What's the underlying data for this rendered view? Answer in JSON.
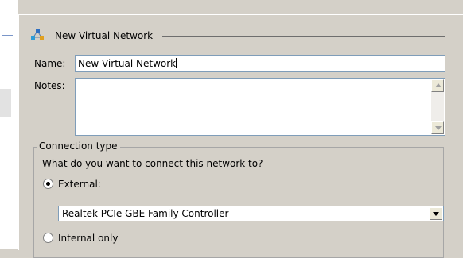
{
  "header": {
    "title": "New Virtual Network",
    "icon": "network-icon"
  },
  "form": {
    "name_label": "Name:",
    "name_value": "New Virtual Network",
    "notes_label": "Notes:",
    "notes_value": ""
  },
  "connection": {
    "group_title": "Connection type",
    "question": "What do you want to connect this network to?",
    "options": [
      {
        "label": "External:",
        "selected": true
      },
      {
        "label": "Internal only",
        "selected": false
      }
    ],
    "adapter_selected": "Realtek PCIe GBE Family Controller"
  },
  "colors": {
    "panel": "#d4d0c8",
    "border": "#7f9db9"
  }
}
